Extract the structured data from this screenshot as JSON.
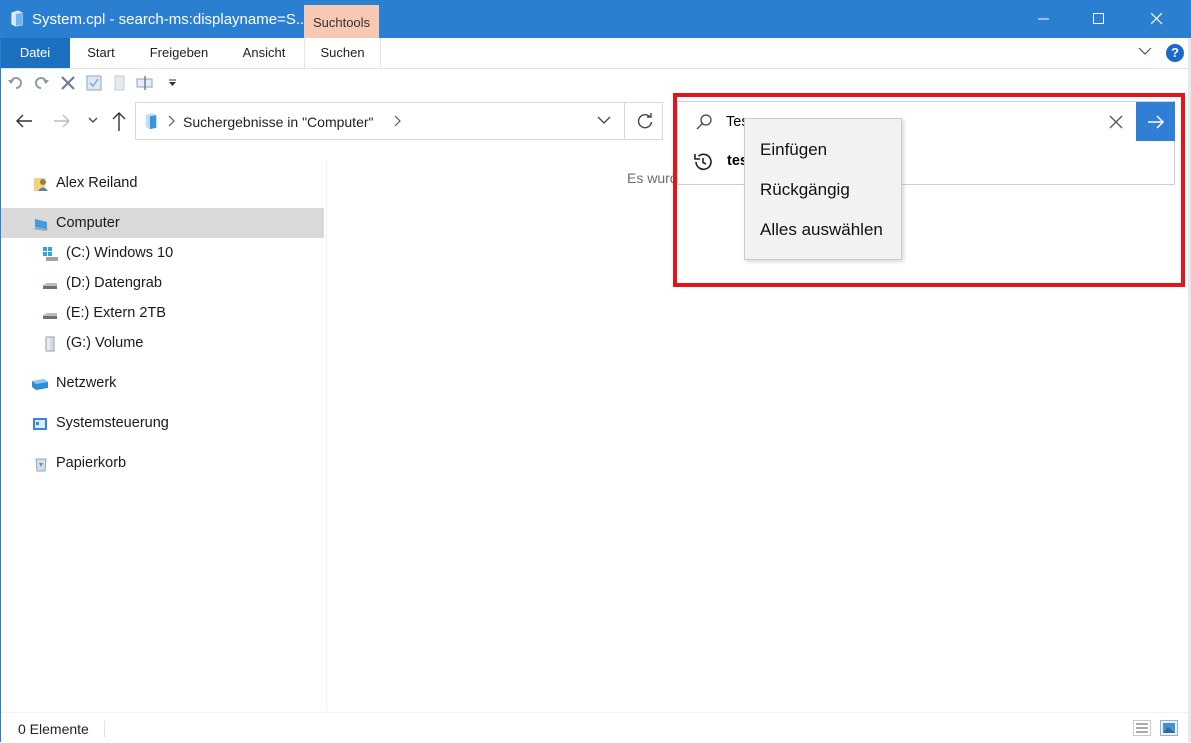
{
  "window": {
    "title": "System.cpl - search-ms:displayname=S...",
    "contextual_tab": "Suchtools",
    "accent_color": "#2b7fd1"
  },
  "ribbon": {
    "tabs": [
      "Datei",
      "Start",
      "Freigeben",
      "Ansicht",
      "Suchen"
    ],
    "help_label": "?"
  },
  "quick_access": {
    "icons": [
      "undo-icon",
      "redo-icon",
      "delete-icon",
      "properties-icon",
      "new-folder-icon",
      "rename-icon",
      "customize-dropdown-icon"
    ]
  },
  "address_bar": {
    "path_text": "Suchergebnisse in \"Computer\""
  },
  "sidebar": {
    "items": [
      {
        "label": "Alex Reiland",
        "icon": "user-folder-icon"
      },
      {
        "label": "Computer",
        "icon": "computer-icon",
        "selected": true
      },
      {
        "label": "(C:) Windows 10",
        "icon": "windows-drive-icon"
      },
      {
        "label": "(D:) Datengrab",
        "icon": "drive-icon"
      },
      {
        "label": "(E:) Extern 2TB",
        "icon": "drive-icon"
      },
      {
        "label": "(G:) Volume",
        "icon": "usb-drive-icon"
      },
      {
        "label": "Netzwerk",
        "icon": "network-icon"
      },
      {
        "label": "Systemsteuerung",
        "icon": "control-panel-icon"
      },
      {
        "label": "Papierkorb",
        "icon": "recycle-bin-icon"
      }
    ]
  },
  "content": {
    "message_visible": "Es wurd"
  },
  "search": {
    "value": "Tes",
    "history_item": "tes"
  },
  "context_menu": {
    "items": [
      "Einfügen",
      "Rückgängig",
      "Alles auswählen"
    ]
  },
  "status_bar": {
    "count_text": "0 Elemente"
  },
  "colors": {
    "highlight_border": "#e3141c",
    "search_go_button": "#2f7fd6",
    "suchtools_tab": "#f7c8b3"
  }
}
